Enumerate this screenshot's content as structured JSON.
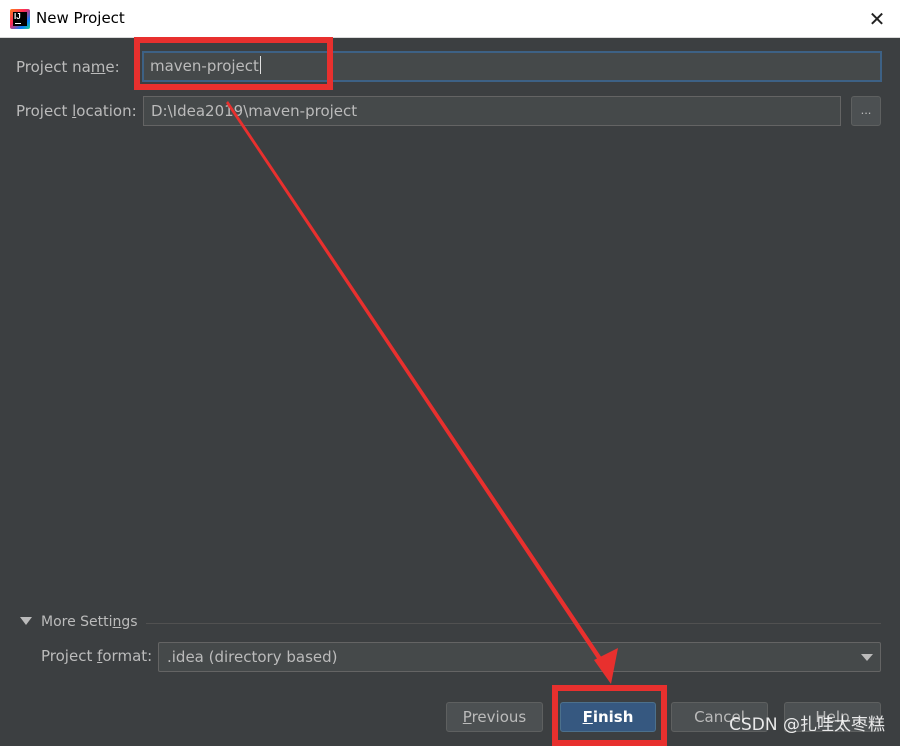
{
  "window": {
    "title": "New Project",
    "close_glyph": "✕",
    "icon": "intellij-idea-icon",
    "icon_text": "IJ"
  },
  "form": {
    "project_name": {
      "label_before": "Project na",
      "label_mnemonic": "m",
      "label_after": "e:",
      "value": "maven-project"
    },
    "project_location": {
      "label_before": "Project ",
      "label_mnemonic": "l",
      "label_after": "ocation:",
      "value": "D:\\Idea2019\\maven-project",
      "browse_label": "..."
    }
  },
  "more_settings": {
    "label_before": "More Setti",
    "label_mnemonic": "n",
    "label_after": "gs",
    "expanded": true,
    "project_format": {
      "label_before": "Project ",
      "label_mnemonic": "f",
      "label_after": "ormat:",
      "selected": ".idea (directory based)"
    }
  },
  "buttons": {
    "previous": {
      "mnemonic": "P",
      "rest": "revious"
    },
    "finish": {
      "mnemonic": "F",
      "rest": "inish"
    },
    "cancel": {
      "label": "Cancel"
    },
    "help": {
      "label": "Help"
    }
  },
  "watermark": "CSDN @扎哇太枣糕",
  "colors": {
    "background": "#3c3f41",
    "field_background": "#45494a",
    "primary_button": "#365880",
    "annotation_red": "#e8302e"
  }
}
